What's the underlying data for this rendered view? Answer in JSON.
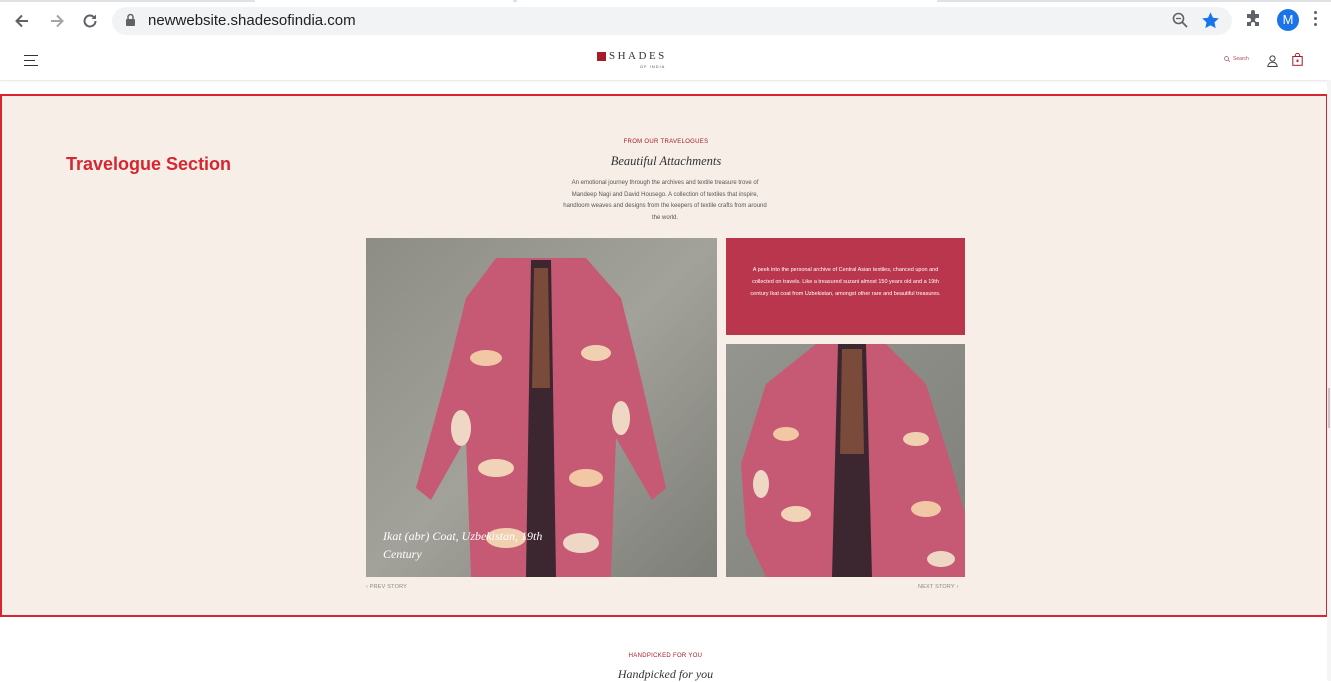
{
  "browser": {
    "url": "newwebsite.shadesofindia.com",
    "profile_initial": "M",
    "icons": [
      "back-icon",
      "forward-icon",
      "reload-icon",
      "lock-icon",
      "zoom-icon",
      "star-icon",
      "extensions-icon",
      "kebab-menu-icon"
    ],
    "colors": {
      "star": "#1a73e8",
      "profile": "#1a73e8"
    }
  },
  "header": {
    "logo_word": "SHADES",
    "logo_sub": "OF INDIA",
    "search_label": "Search",
    "icons": [
      "hamburger-icon",
      "search-icon",
      "user-icon",
      "bag-icon"
    ],
    "colors": {
      "brand": "#a51c2a"
    }
  },
  "travelogue": {
    "annotation": "Travelogue Section",
    "eyebrow": "FROM OUR TRAVELOGUES",
    "title": "Beautiful Attachments",
    "intro": "An emotional journey through the archives and textile treasure trove of Mandeep Nagi and David Housego. A collection of textiles that inspire, handloom weaves and designs from the keepers of textile crafts from around the world.",
    "caption": "Ikat (abr) Coat, Uzbekistan, 19th Century",
    "description": "A peek into the personal archive of Central Asian textiles, chanced upon and collected on travels. Like a treasured suzani almost 150 years old and a 19th century Ikat coat from Uzbekistan, amongst other rare and beautiful treasures.",
    "prev_label": "‹ PREV STORY",
    "next_label": "NEXT STORY ›",
    "colors": {
      "background": "#f6eee7",
      "annotation_border": "#d7262f",
      "panel": "#b9364c"
    }
  },
  "handpicked": {
    "eyebrow": "HANDPICKED FOR YOU",
    "title": "Handpicked for you"
  }
}
